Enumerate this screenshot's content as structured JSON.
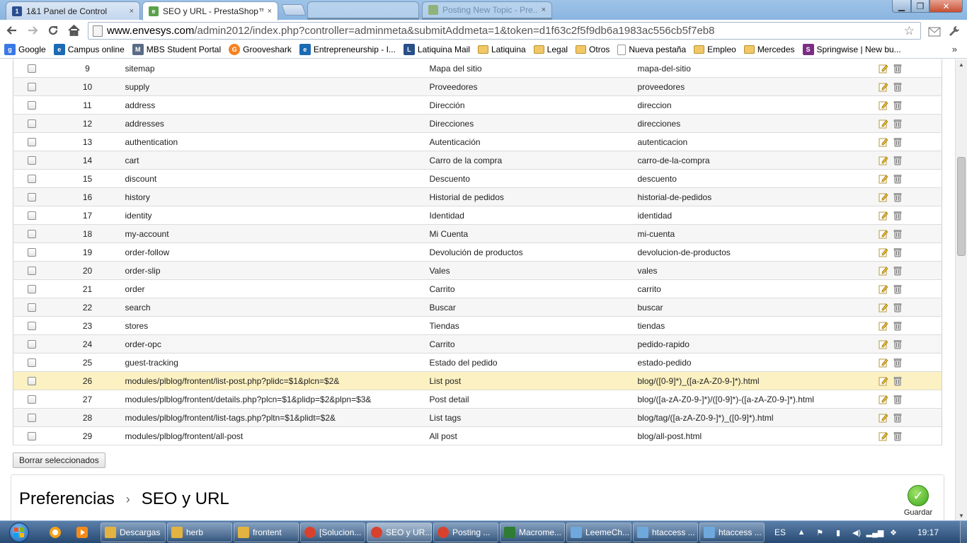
{
  "browser": {
    "tabs": [
      {
        "title": "1&1 Panel de Control",
        "close": "×"
      },
      {
        "title": "SEO y URL - PrestaShop™",
        "close": "×"
      },
      {
        "title": "",
        "close": ""
      },
      {
        "title": "Posting New Topic - Pre...",
        "close": "×"
      }
    ],
    "url_host": "www.envesys.com",
    "url_path": "/admin2012/index.php?controller=adminmeta&submitAddmeta=1&token=d1f63c2f5f9db6a1983ac556cb5f7eb8"
  },
  "bookmarks": [
    {
      "label": "Google",
      "icon": "google-icon",
      "color": "#3b78e7"
    },
    {
      "label": "Campus online",
      "icon": "ie-icon",
      "color": "#1b6ab3"
    },
    {
      "label": "MBS Student Portal",
      "icon": "mbs-icon",
      "color": "#5a6b86"
    },
    {
      "label": "Grooveshark",
      "icon": "grooveshark-icon",
      "color": "#f58220"
    },
    {
      "label": "Entrepreneurship - I...",
      "icon": "ie-icon",
      "color": "#1b6ab3"
    },
    {
      "label": "Latiquina Mail",
      "icon": "mail-icon",
      "color": "#274f8a"
    },
    {
      "label": "Latiquina",
      "icon": "folder-icon",
      "color": ""
    },
    {
      "label": "Legal",
      "icon": "folder-icon",
      "color": ""
    },
    {
      "label": "Otros",
      "icon": "folder-icon",
      "color": ""
    },
    {
      "label": "Nueva pestaña",
      "icon": "page-icon",
      "color": ""
    },
    {
      "label": "Empleo",
      "icon": "folder-icon",
      "color": ""
    },
    {
      "label": "Mercedes",
      "icon": "folder-icon",
      "color": ""
    },
    {
      "label": "Springwise | New bu...",
      "icon": "springwise-icon",
      "color": "#7b2d83"
    }
  ],
  "bookmarks_more": "»",
  "table": {
    "rows": [
      {
        "id": "9",
        "page": "sitemap",
        "title": "Mapa del sitio",
        "url": "mapa-del-sitio",
        "highlight": false
      },
      {
        "id": "10",
        "page": "supply",
        "title": "Proveedores",
        "url": "proveedores",
        "highlight": false
      },
      {
        "id": "11",
        "page": "address",
        "title": "Dirección",
        "url": "direccion",
        "highlight": false
      },
      {
        "id": "12",
        "page": "addresses",
        "title": "Direcciones",
        "url": "direcciones",
        "highlight": false
      },
      {
        "id": "13",
        "page": "authentication",
        "title": "Autenticación",
        "url": "autenticacion",
        "highlight": false
      },
      {
        "id": "14",
        "page": "cart",
        "title": "Carro de la compra",
        "url": "carro-de-la-compra",
        "highlight": false
      },
      {
        "id": "15",
        "page": "discount",
        "title": "Descuento",
        "url": "descuento",
        "highlight": false
      },
      {
        "id": "16",
        "page": "history",
        "title": "Historial de pedidos",
        "url": "historial-de-pedidos",
        "highlight": false
      },
      {
        "id": "17",
        "page": "identity",
        "title": "Identidad",
        "url": "identidad",
        "highlight": false
      },
      {
        "id": "18",
        "page": "my-account",
        "title": "Mi Cuenta",
        "url": "mi-cuenta",
        "highlight": false
      },
      {
        "id": "19",
        "page": "order-follow",
        "title": "Devolución de productos",
        "url": "devolucion-de-productos",
        "highlight": false
      },
      {
        "id": "20",
        "page": "order-slip",
        "title": "Vales",
        "url": "vales",
        "highlight": false
      },
      {
        "id": "21",
        "page": "order",
        "title": "Carrito",
        "url": "carrito",
        "highlight": false
      },
      {
        "id": "22",
        "page": "search",
        "title": "Buscar",
        "url": "buscar",
        "highlight": false
      },
      {
        "id": "23",
        "page": "stores",
        "title": "Tiendas",
        "url": "tiendas",
        "highlight": false
      },
      {
        "id": "24",
        "page": "order-opc",
        "title": "Carrito",
        "url": "pedido-rapido",
        "highlight": false
      },
      {
        "id": "25",
        "page": "guest-tracking",
        "title": "Estado del pedido",
        "url": "estado-pedido",
        "highlight": false
      },
      {
        "id": "26",
        "page": "modules/plblog/frontent/list-post.php?plidc=$1&plcn=$2&",
        "title": "List post",
        "url": "blog/([0-9]*)_([a-zA-Z0-9-]*).html",
        "highlight": true
      },
      {
        "id": "27",
        "page": "modules/plblog/frontent/details.php?plcn=$1&plidp=$2&plpn=$3&",
        "title": "Post detail",
        "url": "blog/([a-zA-Z0-9-]*)/([0-9]*)-([a-zA-Z0-9-]*).html",
        "highlight": false
      },
      {
        "id": "28",
        "page": "modules/plblog/frontent/list-tags.php?pltn=$1&plidt=$2&",
        "title": "List tags",
        "url": "blog/tag/([a-zA-Z0-9-]*)_([0-9]*).html",
        "highlight": false
      },
      {
        "id": "29",
        "page": "modules/plblog/frontent/all-post",
        "title": "All post",
        "url": "blog/all-post.html",
        "highlight": false
      }
    ]
  },
  "bulk_delete_label": "Borrar seleccionados",
  "panel": {
    "crumb_1": "Preferencias",
    "crumb_sep": "›",
    "crumb_2": "SEO y URL",
    "save_label": "Guardar"
  },
  "taskbar": {
    "tasks": [
      {
        "label": "Descargas",
        "icon": "folder-icon",
        "color": "#e3b341"
      },
      {
        "label": "herb",
        "icon": "folder-icon",
        "color": "#e3b341"
      },
      {
        "label": "frontent",
        "icon": "folder-icon",
        "color": "#e3b341"
      },
      {
        "label": "[Solucion...",
        "icon": "chrome-icon",
        "color": "#d9412f"
      },
      {
        "label": "SEO y UR...",
        "icon": "chrome-icon",
        "color": "#d9412f"
      },
      {
        "label": "Posting ...",
        "icon": "chrome-icon",
        "color": "#d9412f"
      },
      {
        "label": "Macrome...",
        "icon": "dreamweaver-icon",
        "color": "#2e7d32"
      },
      {
        "label": "LeemeCh...",
        "icon": "notepad-icon",
        "color": "#6fa8dc"
      },
      {
        "label": "htaccess ...",
        "icon": "notepad-icon",
        "color": "#6fa8dc"
      },
      {
        "label": "htaccess ...",
        "icon": "notepad-icon",
        "color": "#6fa8dc"
      }
    ],
    "lang": "ES",
    "clock": "19:17"
  }
}
